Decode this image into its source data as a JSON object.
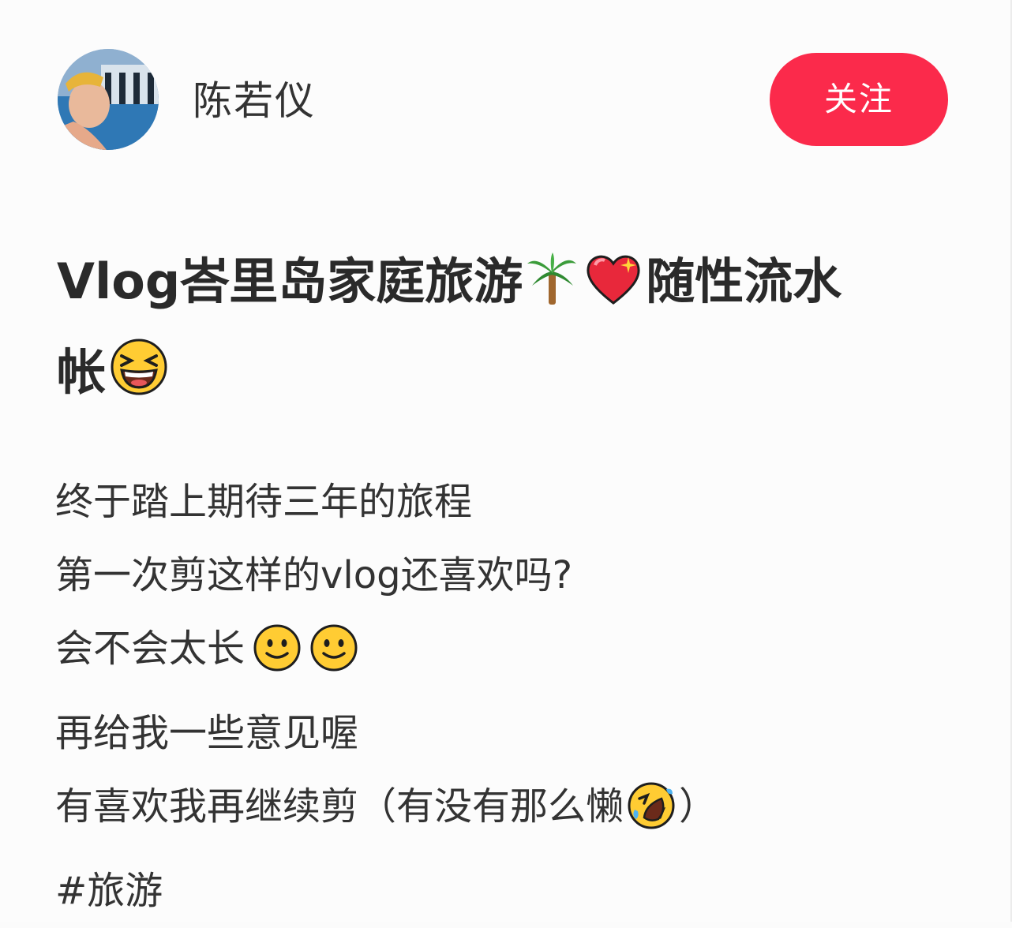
{
  "author": {
    "name": "陈若仪",
    "follow_label": "关注"
  },
  "post": {
    "title_part1": "Vlog峇里岛家庭旅游",
    "title_part2": "随性流水",
    "title_part3": "帐",
    "title_emojis": [
      "palm-tree",
      "sparkling-heart",
      "grinning-squinting-face"
    ],
    "lines": [
      "终于踏上期待三年的旅程",
      "第一次剪这样的vlog还喜欢吗?",
      "会不会太长",
      "再给我一些意见喔",
      "有喜欢我再继续剪（有没有那么懒",
      "）"
    ],
    "hashtag": "#旅游"
  },
  "colors": {
    "follow_button": "#fb2a4b",
    "text": "#333333",
    "title": "#2a2a2a"
  }
}
